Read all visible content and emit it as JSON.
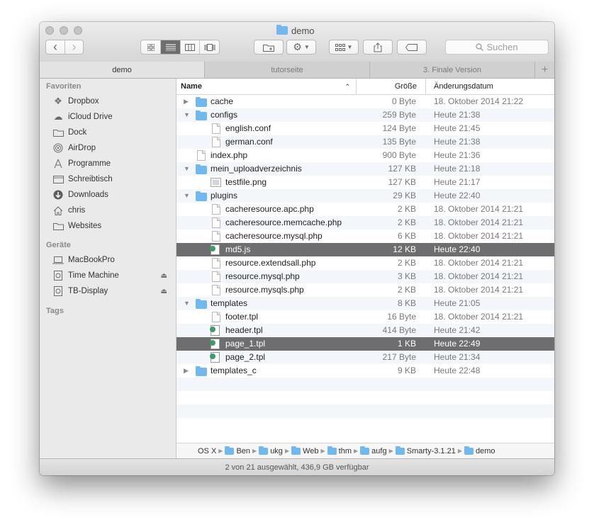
{
  "window": {
    "title": "demo"
  },
  "toolbar": {
    "back_label": "‹",
    "forward_label": "›",
    "search_placeholder": "Suchen"
  },
  "tabs": [
    {
      "label": "demo"
    },
    {
      "label": "tutorseite"
    },
    {
      "label": "3. Finale Version"
    }
  ],
  "sidebar": {
    "favorites_header": "Favoriten",
    "favorites": [
      {
        "label": "Dropbox",
        "icon": "dropbox-icon"
      },
      {
        "label": "iCloud Drive",
        "icon": "cloud-icon"
      },
      {
        "label": "Dock",
        "icon": "folder-icon"
      },
      {
        "label": "AirDrop",
        "icon": "airdrop-icon"
      },
      {
        "label": "Programme",
        "icon": "apps-icon"
      },
      {
        "label": "Schreibtisch",
        "icon": "desktop-icon"
      },
      {
        "label": "Downloads",
        "icon": "download-icon"
      },
      {
        "label": "chris",
        "icon": "home-icon"
      },
      {
        "label": "Websites",
        "icon": "folder-icon"
      }
    ],
    "devices_header": "Geräte",
    "devices": [
      {
        "label": "MacBookPro",
        "icon": "laptop-icon"
      },
      {
        "label": "Time Machine",
        "icon": "disk-icon"
      },
      {
        "label": "TB-Display",
        "icon": "disk-icon"
      }
    ],
    "tags_header": "Tags"
  },
  "columns": {
    "name": "Name",
    "size": "Größe",
    "date": "Änderungsdatum"
  },
  "files": [
    {
      "name": "cache",
      "size": "0 Byte",
      "date": "18. Oktober 2014 21:22",
      "type": "folder",
      "level": 0,
      "expanded": false,
      "selected": false
    },
    {
      "name": "configs",
      "size": "259 Byte",
      "date": "Heute 21:38",
      "type": "folder",
      "level": 0,
      "expanded": true,
      "selected": false
    },
    {
      "name": "english.conf",
      "size": "124 Byte",
      "date": "Heute 21:45",
      "type": "doc",
      "level": 1,
      "selected": false
    },
    {
      "name": "german.conf",
      "size": "135 Byte",
      "date": "Heute 21:38",
      "type": "doc",
      "level": 1,
      "selected": false
    },
    {
      "name": "index.php",
      "size": "900 Byte",
      "date": "Heute 21:36",
      "type": "doc",
      "level": 0,
      "selected": false
    },
    {
      "name": "mein_uploadverzeichnis",
      "size": "127 KB",
      "date": "Heute 21:18",
      "type": "folder",
      "level": 0,
      "expanded": true,
      "selected": false
    },
    {
      "name": "testfile.png",
      "size": "127 KB",
      "date": "Heute 21:17",
      "type": "image",
      "level": 1,
      "selected": false
    },
    {
      "name": "plugins",
      "size": "29 KB",
      "date": "Heute 22:40",
      "type": "folder",
      "level": 0,
      "expanded": true,
      "selected": false
    },
    {
      "name": "cacheresource.apc.php",
      "size": "2 KB",
      "date": "18. Oktober 2014 21:21",
      "type": "doc",
      "level": 1,
      "selected": false
    },
    {
      "name": "cacheresource.memcache.php",
      "size": "2 KB",
      "date": "18. Oktober 2014 21:21",
      "type": "doc",
      "level": 1,
      "selected": false
    },
    {
      "name": "cacheresource.mysql.php",
      "size": "6 KB",
      "date": "18. Oktober 2014 21:21",
      "type": "doc",
      "level": 1,
      "selected": false
    },
    {
      "name": "md5.js",
      "size": "12 KB",
      "date": "Heute 22:40",
      "type": "script",
      "level": 1,
      "selected": true
    },
    {
      "name": "resource.extendsall.php",
      "size": "2 KB",
      "date": "18. Oktober 2014 21:21",
      "type": "doc",
      "level": 1,
      "selected": false
    },
    {
      "name": "resource.mysql.php",
      "size": "3 KB",
      "date": "18. Oktober 2014 21:21",
      "type": "doc",
      "level": 1,
      "selected": false
    },
    {
      "name": "resource.mysqls.php",
      "size": "2 KB",
      "date": "18. Oktober 2014 21:21",
      "type": "doc",
      "level": 1,
      "selected": false
    },
    {
      "name": "templates",
      "size": "8 KB",
      "date": "Heute 21:05",
      "type": "folder",
      "level": 0,
      "expanded": true,
      "selected": false
    },
    {
      "name": "footer.tpl",
      "size": "16 Byte",
      "date": "18. Oktober 2014 21:21",
      "type": "doc",
      "level": 1,
      "selected": false
    },
    {
      "name": "header.tpl",
      "size": "414 Byte",
      "date": "Heute 21:42",
      "type": "script",
      "level": 1,
      "selected": false
    },
    {
      "name": "page_1.tpl",
      "size": "1 KB",
      "date": "Heute 22:49",
      "type": "script",
      "level": 1,
      "selected": true
    },
    {
      "name": "page_2.tpl",
      "size": "217 Byte",
      "date": "Heute 21:34",
      "type": "script",
      "level": 1,
      "selected": false
    },
    {
      "name": "templates_c",
      "size": "9 KB",
      "date": "Heute 22:48",
      "type": "folder",
      "level": 0,
      "expanded": false,
      "selected": false
    }
  ],
  "path": [
    {
      "label": "OS X",
      "icon": "disk-icon"
    },
    {
      "label": "Ben",
      "icon": "user-folder-icon"
    },
    {
      "label": "ukg",
      "icon": "folder-icon"
    },
    {
      "label": "Web",
      "icon": "folder-icon"
    },
    {
      "label": "thm",
      "icon": "folder-icon"
    },
    {
      "label": "aufg",
      "icon": "folder-icon"
    },
    {
      "label": "Smarty-3.1.21",
      "icon": "folder-icon"
    },
    {
      "label": "demo",
      "icon": "folder-icon"
    }
  ],
  "status": {
    "text": "2 von 21 ausgewählt, 436,9 GB verfügbar"
  }
}
